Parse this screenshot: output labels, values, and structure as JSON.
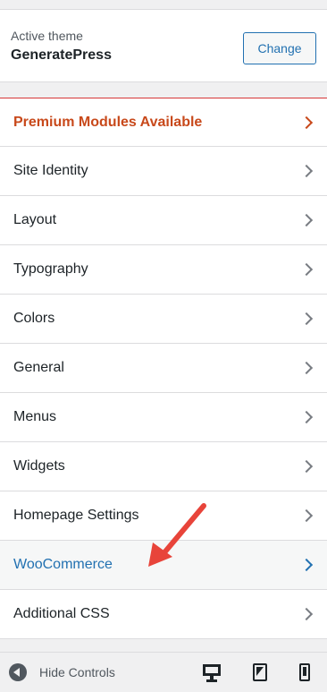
{
  "theme": {
    "label": "Active theme",
    "name": "GeneratePress",
    "change_label": "Change"
  },
  "menu": {
    "items": [
      {
        "label": "Premium Modules Available"
      },
      {
        "label": "Site Identity"
      },
      {
        "label": "Layout"
      },
      {
        "label": "Typography"
      },
      {
        "label": "Colors"
      },
      {
        "label": "General"
      },
      {
        "label": "Menus"
      },
      {
        "label": "Widgets"
      },
      {
        "label": "Homepage Settings"
      },
      {
        "label": "WooCommerce"
      },
      {
        "label": "Additional CSS"
      }
    ]
  },
  "footer": {
    "hide_controls_label": "Hide Controls",
    "device_icons": [
      "desktop-icon",
      "tablet-icon",
      "mobile-icon"
    ]
  },
  "colors": {
    "accent": "#2271b1",
    "premium": "#c8491b",
    "annotation_arrow": "#e8443a"
  }
}
